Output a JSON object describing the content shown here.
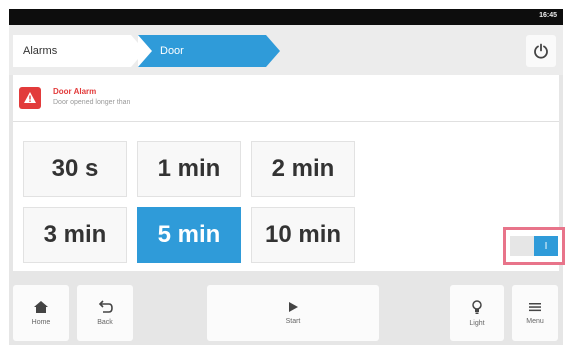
{
  "status_bar": {
    "time": "16:45"
  },
  "breadcrumb": [
    {
      "label": "Alarms"
    },
    {
      "label": "Door"
    }
  ],
  "icons": {
    "power": "power-icon",
    "warning": "warning-icon",
    "home": "home-icon",
    "back": "back-arrow-icon",
    "play": "play-icon",
    "light": "light-bulb-icon",
    "menu": "menu-icon"
  },
  "colors": {
    "accent": "#2f9bd9",
    "alarm": "#e23b3b",
    "highlight": "#e8748a"
  },
  "alarm": {
    "title": "Door Alarm",
    "subtitle": "Door opened longer than"
  },
  "options": [
    {
      "label": "30 s",
      "selected": false
    },
    {
      "label": "1 min",
      "selected": false
    },
    {
      "label": "2 min",
      "selected": false
    },
    {
      "label": "3 min",
      "selected": false
    },
    {
      "label": "5 min",
      "selected": true
    },
    {
      "label": "10 min",
      "selected": false
    }
  ],
  "toggle": {
    "label": "I",
    "state": "on"
  },
  "nav": {
    "home": "Home",
    "back": "Back",
    "start": "Start",
    "light": "Light",
    "menu": "Menu"
  }
}
